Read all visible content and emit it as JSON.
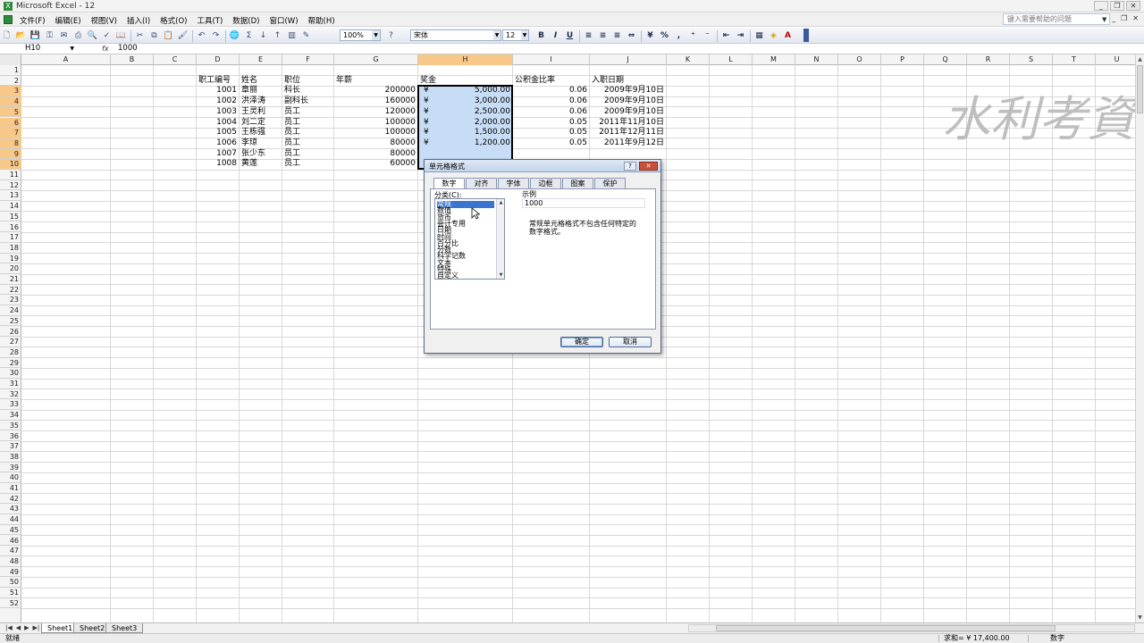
{
  "window": {
    "title": "Microsoft Excel - 12",
    "buttons": [
      "_",
      "❐",
      "✕"
    ]
  },
  "menu": {
    "items": [
      "文件(F)",
      "编辑(E)",
      "视图(V)",
      "插入(I)",
      "格式(O)",
      "工具(T)",
      "数据(D)",
      "窗口(W)",
      "帮助(H)"
    ],
    "help_placeholder": "键入需要帮助的问题",
    "doc_buttons": [
      "_",
      "❐",
      "✕"
    ]
  },
  "toolbar": {
    "zoom": "100%",
    "font": "宋体",
    "size": "12",
    "bold": "B",
    "italic": "I",
    "underline": "U"
  },
  "formula_bar": {
    "name_box": "H10",
    "fx": "fx",
    "content": "1000"
  },
  "columns": [
    "A",
    "B",
    "C",
    "D",
    "E",
    "F",
    "G",
    "H",
    "I",
    "J",
    "K",
    "L",
    "M",
    "N",
    "O",
    "P",
    "Q",
    "R",
    "S",
    "T",
    "U"
  ],
  "selected_column": "H",
  "row_count": 52,
  "selected_rows": [
    3,
    4,
    5,
    6,
    7,
    8,
    9,
    10
  ],
  "table": {
    "headers": {
      "D": "职工编号",
      "E": "姓名",
      "F": "职位",
      "G": "年薪",
      "H": "奖金",
      "I": "公积金比率",
      "J": "入职日期"
    },
    "rows": [
      {
        "row": 3,
        "D": "1001",
        "E": "章丽",
        "F": "科长",
        "G": "200000",
        "H_sym": "¥",
        "H": "5,000.00",
        "I": "0.06",
        "J": "2009年9月10日"
      },
      {
        "row": 4,
        "D": "1002",
        "E": "洪泽涛",
        "F": "副科长",
        "G": "160000",
        "H_sym": "¥",
        "H": "3,000.00",
        "I": "0.06",
        "J": "2009年9月10日"
      },
      {
        "row": 5,
        "D": "1003",
        "E": "王灵利",
        "F": "员工",
        "G": "120000",
        "H_sym": "¥",
        "H": "2,500.00",
        "I": "0.06",
        "J": "2009年9月10日"
      },
      {
        "row": 6,
        "D": "1004",
        "E": "刘二定",
        "F": "员工",
        "G": "100000",
        "H_sym": "¥",
        "H": "2,000.00",
        "I": "0.05",
        "J": "2011年11月10日"
      },
      {
        "row": 7,
        "D": "1005",
        "E": "王栋强",
        "F": "员工",
        "G": "100000",
        "H_sym": "¥",
        "H": "1,500.00",
        "I": "0.05",
        "J": "2011年12月11日"
      },
      {
        "row": 8,
        "D": "1006",
        "E": "李琼",
        "F": "员工",
        "G": "80000",
        "H_sym": "¥",
        "H": "1,200.00",
        "I": "0.05",
        "J": "2011年9月12日"
      },
      {
        "row": 9,
        "D": "1007",
        "E": "张少东",
        "F": "员工",
        "G": "80000",
        "H_sym": "",
        "H": "",
        "I": "",
        "J": ""
      },
      {
        "row": 10,
        "D": "1008",
        "E": "黄莲",
        "F": "员工",
        "G": "60000",
        "H_sym": "",
        "H": "",
        "I": "",
        "J": ""
      }
    ]
  },
  "sheets": [
    "Sheet1",
    "Sheet2",
    "Sheet3"
  ],
  "active_sheet": "Sheet1",
  "status": {
    "ready": "就绪",
    "sum": "求和= ¥ 17,400.00",
    "mode": "数字"
  },
  "dialog": {
    "title": "单元格格式",
    "help": "?",
    "close": "✕",
    "tabs": [
      "数字",
      "对齐",
      "字体",
      "边框",
      "图案",
      "保护"
    ],
    "active_tab": "数字",
    "category_label": "分类(C):",
    "categories": [
      "常规",
      "数值",
      "货币",
      "会计专用",
      "日期",
      "时间",
      "百分比",
      "分数",
      "科学记数",
      "文本",
      "特殊",
      "自定义"
    ],
    "selected_category": "常规",
    "sample_label": "示例",
    "sample_value": "1000",
    "description": "常规单元格格式不包含任何特定的数字格式。",
    "ok": "确定",
    "cancel": "取消"
  },
  "watermark": "水利考资"
}
